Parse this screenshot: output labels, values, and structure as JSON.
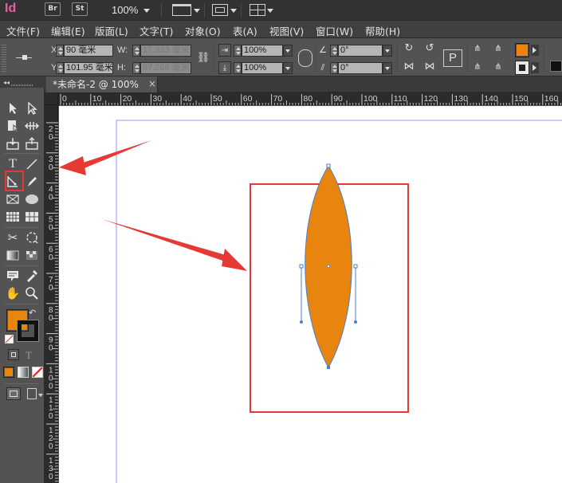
{
  "app": {
    "logo": "Id",
    "bridge_label": "Br",
    "stock_label": "St",
    "zoom": "100%"
  },
  "menu": [
    {
      "label": "文件(F)"
    },
    {
      "label": "编辑(E)"
    },
    {
      "label": "版面(L)"
    },
    {
      "label": "文字(T)"
    },
    {
      "label": "对象(O)"
    },
    {
      "label": "表(A)"
    },
    {
      "label": "视图(V)"
    },
    {
      "label": "窗口(W)"
    },
    {
      "label": "帮助(H)"
    }
  ],
  "control": {
    "x_label": "X:",
    "x_value": "90 毫米",
    "y_label": "Y:",
    "y_value": "101.95 毫米",
    "w_label": "W:",
    "w_value": "17.333 毫米",
    "h_label": "H:",
    "h_value": "67.268 毫米",
    "scale_x": "100%",
    "scale_y": "100%",
    "rotate": "0°",
    "shear": "0°",
    "fill_color": "#e8850f"
  },
  "document": {
    "tab_label": "*未命名-2 @ 100%",
    "close_glyph": "×"
  },
  "rulers": {
    "h_ticks": [
      "0",
      "10",
      "20",
      "30",
      "40",
      "50",
      "60",
      "70",
      "80",
      "90",
      "100",
      "110",
      "120",
      "130",
      "140",
      "150",
      "160"
    ],
    "v_ticks": [
      "2\n0",
      "3\n0",
      "4\n0",
      "5\n0",
      "6\n0",
      "7\n0",
      "8\n0",
      "9\n0",
      "1\n0\n0",
      "1\n1\n0",
      "1\n2\n0",
      "1\n3\n0"
    ]
  },
  "colors": {
    "shape_fill": "#e8850f",
    "shape_stroke": "#4a7fd0",
    "annotation_red": "#e53935",
    "margin_guide": "#8f86ff"
  },
  "icons": {
    "selection": "selection-tool-icon",
    "direct_selection": "direct-selection-tool-icon",
    "pen": "pen-tool-icon",
    "line": "line-tool-icon"
  }
}
